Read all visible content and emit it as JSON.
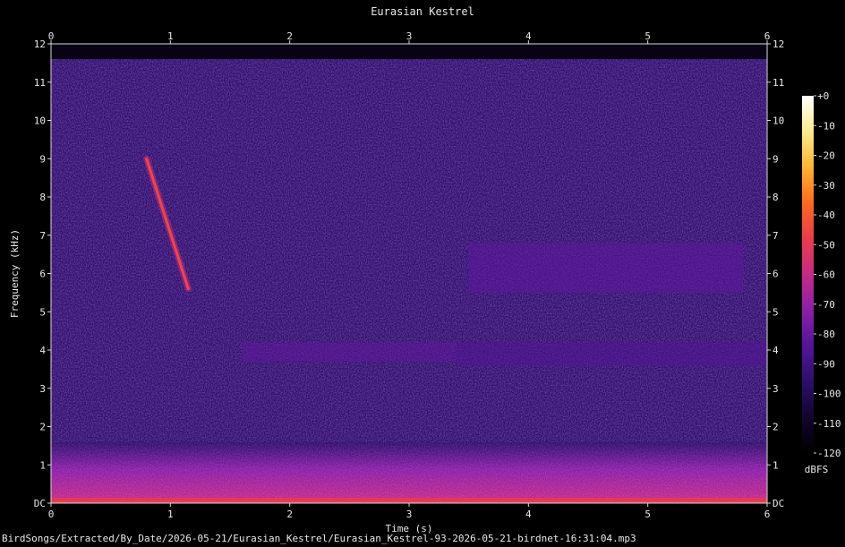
{
  "title": "Eurasian Kestrel",
  "footer": "BirdSongs/Extracted/By_Date/2026-05-21/Eurasian_Kestrel/Eurasian_Kestrel-93-2026-05-21-birdnet-16:31:04.mp3",
  "chart_data": {
    "type": "heatmap",
    "title": "Eurasian Kestrel",
    "xlabel": "Time (s)",
    "ylabel": "Frequency (kHz)",
    "xlim": [
      0,
      6
    ],
    "ylim": [
      0,
      12
    ],
    "x_ticks": [
      "0",
      "1",
      "2",
      "3",
      "4",
      "5",
      "6"
    ],
    "y_ticks": [
      "DC",
      "1",
      "2",
      "3",
      "4",
      "5",
      "6",
      "7",
      "8",
      "9",
      "10",
      "11",
      "12"
    ],
    "colorbar": {
      "label": "dBFS",
      "range": [
        -120,
        0
      ],
      "ticks": [
        "+0",
        "-10",
        "-20",
        "-30",
        "-40",
        "-50",
        "-60",
        "-70",
        "-80",
        "-90",
        "-100",
        "-110",
        "-120"
      ],
      "colormap": [
        "#000000",
        "#12052e",
        "#2c0f6a",
        "#55149a",
        "#8a1fa8",
        "#c42a86",
        "#ec3a4c",
        "#fb6a1c",
        "#fcb432",
        "#fdea8e",
        "#ffffff"
      ]
    },
    "background_level_dbfs": -95,
    "low_band": {
      "freq_khz": [
        0,
        1.6
      ],
      "level_dbfs": -70
    },
    "features": [
      {
        "kind": "sweep",
        "t": [
          0.8,
          1.15
        ],
        "f_khz": [
          9.0,
          5.6
        ],
        "level_dbfs": -45
      },
      {
        "kind": "band",
        "t": [
          1.6,
          3.4
        ],
        "f_khz": [
          3.7,
          4.2
        ],
        "level_dbfs": -82
      },
      {
        "kind": "band",
        "t": [
          3.5,
          5.8
        ],
        "f_khz": [
          5.5,
          6.8
        ],
        "level_dbfs": -82
      },
      {
        "kind": "band",
        "t": [
          3.4,
          6.0
        ],
        "f_khz": [
          3.6,
          4.2
        ],
        "level_dbfs": -85
      }
    ]
  }
}
